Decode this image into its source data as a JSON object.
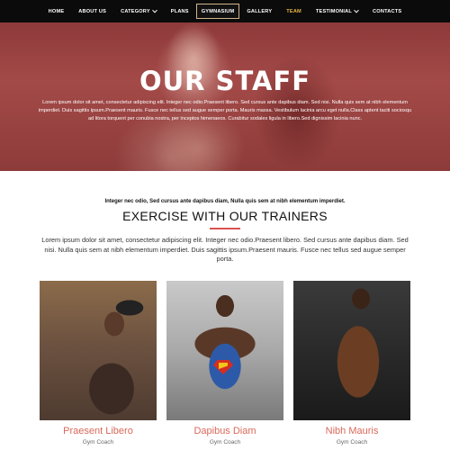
{
  "nav": {
    "items": [
      {
        "label": "HOME"
      },
      {
        "label": "ABOUT US"
      },
      {
        "label": "CATEGORY"
      },
      {
        "label": "PLANS"
      },
      {
        "label": "GYMNASIUM"
      },
      {
        "label": "GALLERY"
      },
      {
        "label": "TEAM"
      },
      {
        "label": "TESTIMONIAL"
      },
      {
        "label": "CONTACTS"
      }
    ],
    "active": "GYMNASIUM",
    "accent_color": "#e6b845"
  },
  "hero": {
    "title": "OUR STAFF",
    "text": "Lorem ipsum dolor sit amet, consectetur adipiscing elit. Integer nec odio.Praesent libero. Sed cursus ante dapibus diam. Sed nisi. Nulla quis sem at nibh elementum imperdiet. Duis sagittis ipsum.Praesent mauris. Fusce nec tellus sed augue semper porta. Mauris massa. Vestibulum lacinia arcu eget nulla.Class aptent taciti sociosqu ad litora torquent per conubia nostra, per inceptos himenaeos. Curabitur sodales ligula in libero.Sed dignissim lacinia nunc."
  },
  "section": {
    "subtitle": "Integer nec odio, Sed cursus ante dapibus diam, Nulla quis sem at nibh elementum imperdiet.",
    "title": "EXERCISE WITH OUR TRAINERS",
    "description": "Lorem ipsum dolor sit amet, consectetur adipiscing elit. Integer nec odio.Praesent libero. Sed cursus ante dapibus diam. Sed nisi. Nulla quis sem at nibh elementum imperdiet. Duis sagittis ipsum.Praesent mauris. Fusce nec tellus sed augue semper porta.",
    "accent_color": "#d9534f"
  },
  "trainers": [
    {
      "name": "Praesent Libero",
      "role": "Gym Coach"
    },
    {
      "name": "Dapibus Diam",
      "role": "Gym Coach"
    },
    {
      "name": "Nibh Mauris",
      "role": "Gym Coach"
    }
  ]
}
